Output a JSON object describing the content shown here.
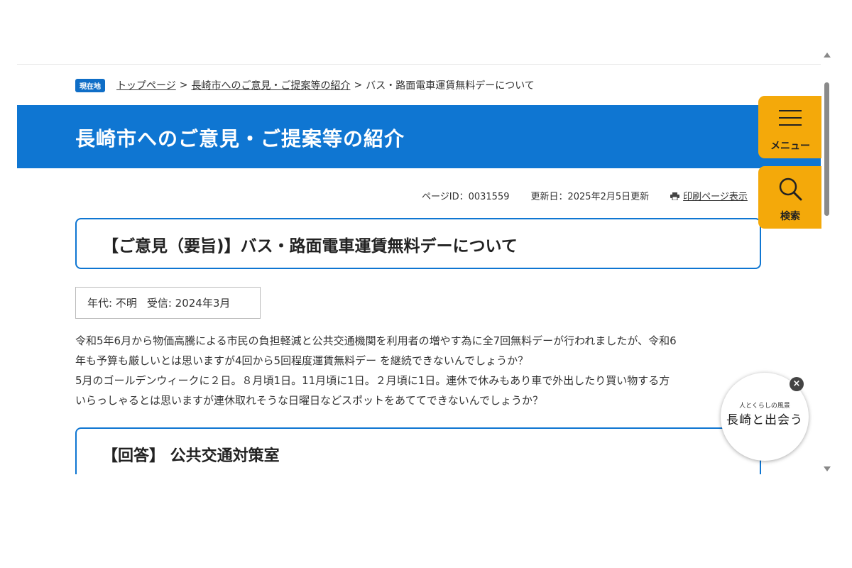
{
  "breadcrumb": {
    "badge": "現在地",
    "items": [
      "トップページ",
      "長崎市へのご意見・ご提案等の紹介"
    ],
    "separator": ">",
    "current": "バス・路面電車運賃無料デーについて"
  },
  "banner": {
    "title": "長崎市へのご意見・ご提案等の紹介",
    "color": "#0f76d2"
  },
  "meta": {
    "page_id": "ページID：0031559",
    "updated": "更新日：2025年2月5日更新",
    "print": "印刷ページ表示"
  },
  "heading": "【ご意見（要旨)】バス・路面電車運賃無料デーについて",
  "info": {
    "age": "年代: 不明",
    "received": "受信: 2024年3月"
  },
  "body": {
    "lines": [
      "令和5年6月から物価高騰による市民の負担軽減と公共交通機関を利用者の増やす為に全7回無料デーが行われましたが、令和6",
      "年も予算も厳しいとは思いますが4回から5回程度運賃無料デー を継続できないんでしょうか？",
      "5月のゴールデンウィークに２日。８月頃1日。11月頃に1日。２月頃に1日。連休で休みもあり車で外出したり買い物する方",
      "いらっしゃるとは思いますが連休取れそうな日曜日などスポットをあててできないんでしょうか？"
    ]
  },
  "answer": {
    "heading": "【回答】 公共交通対策室"
  },
  "side": {
    "menu_label": "メニュー",
    "search_label": "検索",
    "color": "#f4a90a"
  },
  "promo": {
    "subtitle": "人とくらしの風景",
    "title": "長崎と出会う",
    "close": "×"
  }
}
